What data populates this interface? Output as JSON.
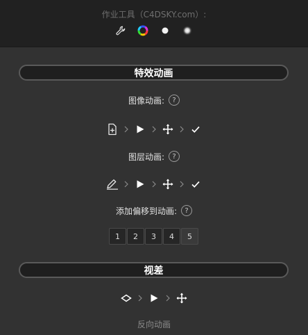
{
  "header": {
    "title": "作业工具（C4DSKY.com）:",
    "tools": [
      "wrench-icon",
      "color-wheel-icon",
      "white-dot-icon",
      "soft-light-icon"
    ]
  },
  "sections": {
    "effects_title": "特效动画",
    "parallax_title": "视差"
  },
  "image_animation": {
    "label": "图像动画:",
    "help": "?"
  },
  "layer_animation": {
    "label": "图层动画:",
    "help": "?"
  },
  "offset_animation": {
    "label": "添加偏移到动画:",
    "help": "?",
    "numbers": [
      "1",
      "2",
      "3",
      "4",
      "5"
    ]
  },
  "footer": {
    "label": "反向动画"
  },
  "colors": {
    "background": "#323232",
    "header": "#212121",
    "section_bar": "#1f1f1f",
    "text": "#ffffff"
  }
}
